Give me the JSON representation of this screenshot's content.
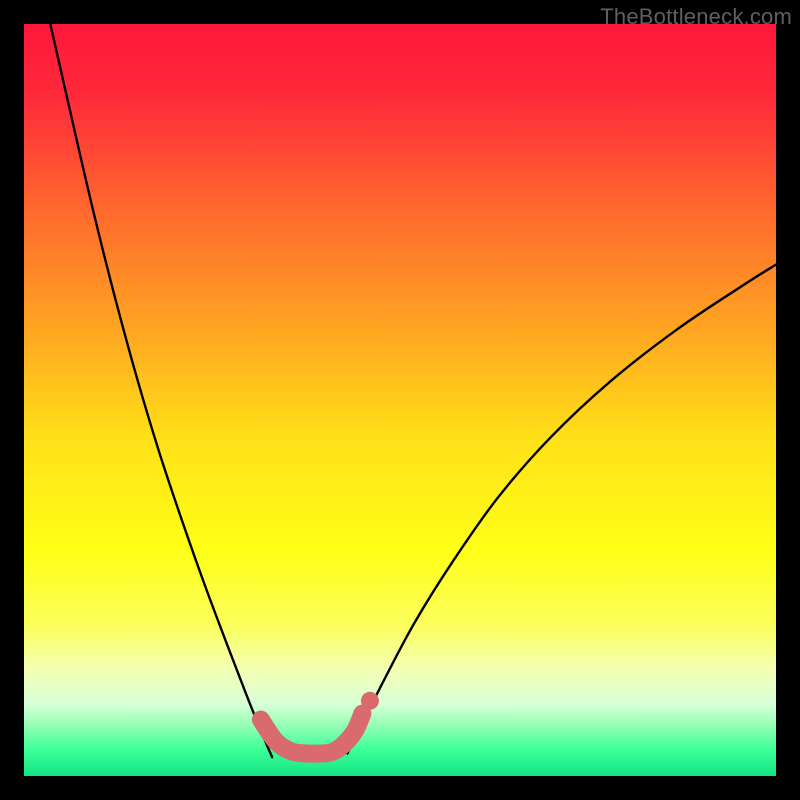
{
  "watermark": {
    "text": "TheBottleneck.com"
  },
  "chart_data": {
    "type": "line",
    "title": "",
    "xlabel": "",
    "ylabel": "",
    "xlim": [
      0,
      100
    ],
    "ylim": [
      0,
      100
    ],
    "grid": false,
    "background_gradient": {
      "stops": [
        {
          "offset": 0.0,
          "color": "#ff173b"
        },
        {
          "offset": 0.1,
          "color": "#ff2b3a"
        },
        {
          "offset": 0.25,
          "color": "#ff6a2e"
        },
        {
          "offset": 0.4,
          "color": "#ffa321"
        },
        {
          "offset": 0.55,
          "color": "#ffe018"
        },
        {
          "offset": 0.7,
          "color": "#ffff17"
        },
        {
          "offset": 0.8,
          "color": "#fbff5d"
        },
        {
          "offset": 0.86,
          "color": "#f3ffb5"
        },
        {
          "offset": 0.905,
          "color": "#d7ffd8"
        },
        {
          "offset": 0.935,
          "color": "#8effb2"
        },
        {
          "offset": 0.965,
          "color": "#3dff98"
        },
        {
          "offset": 1.0,
          "color": "#13e585"
        }
      ]
    },
    "series": [
      {
        "name": "left-curve",
        "x": [
          3.5,
          6,
          9,
          12,
          15,
          18,
          21,
          24,
          27,
          29.5,
          31.5,
          33
        ],
        "y": [
          100,
          89,
          76,
          64,
          53,
          43,
          34,
          25.5,
          17.5,
          11,
          6,
          2.5
        ]
      },
      {
        "name": "right-curve",
        "x": [
          43,
          45,
          48,
          52,
          57,
          63,
          70,
          78,
          87,
          96,
          100
        ],
        "y": [
          3,
          7,
          13,
          20.5,
          28.5,
          37,
          45,
          52.5,
          59.5,
          65.5,
          68
        ]
      },
      {
        "name": "valley-marker",
        "x": [
          31.5,
          33.5,
          35.5,
          37.5,
          39.5,
          41,
          42.5,
          44,
          45
        ],
        "y": [
          7.5,
          4.6,
          3.3,
          3.0,
          3.0,
          3.2,
          4.2,
          6.0,
          8.3
        ]
      }
    ],
    "marker_extra": {
      "x": 46.0,
      "y": 10.0
    }
  }
}
